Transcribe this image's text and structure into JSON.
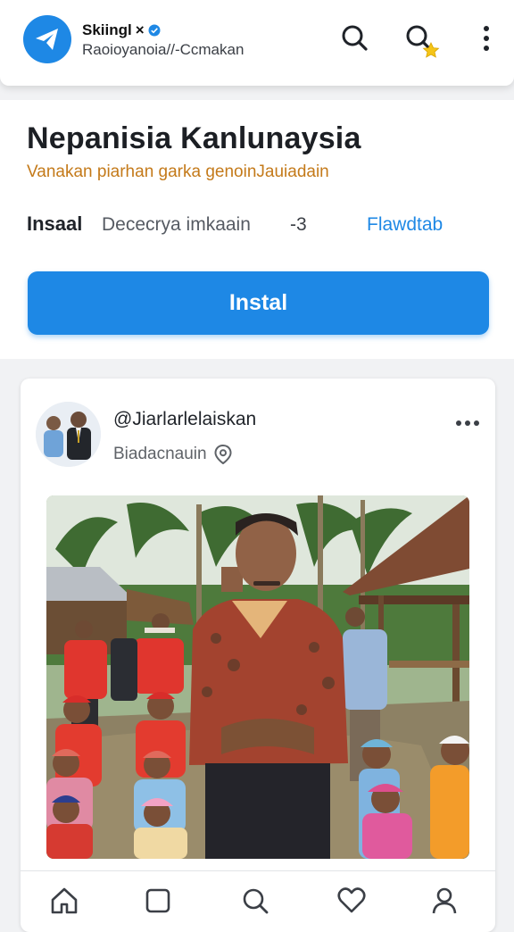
{
  "app": {
    "name": "Skiingl",
    "name_suffix": "×",
    "subtitle": "Raoioyanoia//-Ccmakan"
  },
  "header_icons": [
    "telegram-logo-icon",
    "verified-badge-icon",
    "search-icon",
    "search-starred-icon",
    "more-vertical-icon"
  ],
  "hero": {
    "title": "Nepanisia Kanlunaysia",
    "subtitle": "Vanakan piarhan garka genoinJauiadain",
    "meta_label": "Insaal",
    "meta_desc": "Dececrya imkaain",
    "meta_count": "-3",
    "meta_link": "Flawdtab",
    "install_label": "Instal"
  },
  "post": {
    "username": "@Jiarlarlelaiskan",
    "location": "Biadacnauin",
    "location_icon": "location-pin-icon",
    "more_icon": "more-horizontal-icon"
  },
  "nav": [
    "home-icon",
    "square-icon",
    "search-icon",
    "heart-icon",
    "profile-icon"
  ],
  "colors": {
    "accent": "#1e88e5",
    "subtitle_orange": "#c47a1a",
    "background": "#f1f2f4"
  }
}
